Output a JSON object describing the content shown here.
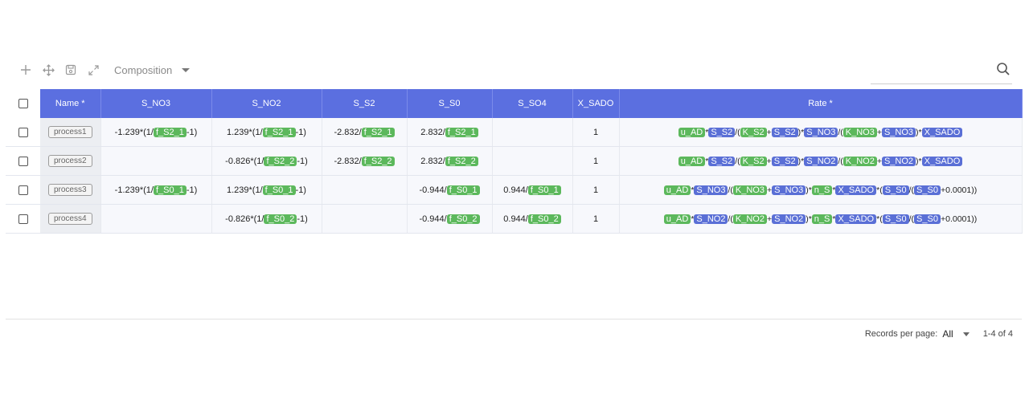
{
  "toolbar": {
    "view_label": "Composition"
  },
  "search": {
    "placeholder": ""
  },
  "columns": {
    "name": "Name *",
    "s_no3": "S_NO3",
    "s_no2": "S_NO2",
    "s_s2": "S_S2",
    "s_s0": "S_S0",
    "s_so4": "S_SO4",
    "x_sado": "X_SADO",
    "rate": "Rate *"
  },
  "rows": [
    {
      "name": "process1",
      "s_no3": "-1.239*(1/[f_S2_1]-1)",
      "s_no2": "1.239*(1/[f_S2_1]-1)",
      "s_s2": "-2.832/[f_S2_1]",
      "s_s0": "2.832/[f_S2_1]",
      "s_so4": "",
      "x_sado": "1",
      "rate": "[u_AD]*[S_S2]/([K_S2]+[S_S2])*[S_NO3]/([K_NO3]+[S_NO3])*[X_SADO]"
    },
    {
      "name": "process2",
      "s_no3": "",
      "s_no2": "-0.826*(1/[f_S2_2]-1)",
      "s_s2": "-2.832/[f_S2_2]",
      "s_s0": "2.832/[f_S2_2]",
      "s_so4": "",
      "x_sado": "1",
      "rate": "[u_AD]*[S_S2]/([K_S2]+[S_S2])*[S_NO2]/([K_NO2]+[S_NO2])*[X_SADO]"
    },
    {
      "name": "process3",
      "s_no3": "-1.239*(1/[f_S0_1]-1)",
      "s_no2": "1.239*(1/[f_S0_1]-1)",
      "s_s2": "",
      "s_s0": "-0.944/[f_S0_1]",
      "s_so4": "0.944/[f_S0_1]",
      "x_sado": "1",
      "rate": "[u_AD]*[S_NO3]/([K_NO3]+[S_NO3])*[n_S]*[X_SADO]*([S_S0]/([S_S0]+0.0001))"
    },
    {
      "name": "process4",
      "s_no3": "",
      "s_no2": "-0.826*(1/[f_S0_2]-1)",
      "s_s2": "",
      "s_s0": "-0.944/[f_S0_2]",
      "s_so4": "0.944/[f_S0_2]",
      "x_sado": "1",
      "rate": "[u_AD]*[S_NO2]/([K_NO2]+[S_NO2])*[n_S]*[X_SADO]*([S_S0]/([S_S0]+0.0001))"
    }
  ],
  "token_colors": {
    "param": "#5cb85c",
    "component": "#5a6fd6",
    "components": [
      "S_S2",
      "S_NO3",
      "S_NO2",
      "X_SADO",
      "S_S0"
    ]
  },
  "pagination": {
    "records_label": "Records per page:",
    "records_value": "All",
    "range": "1-4 of 4"
  }
}
